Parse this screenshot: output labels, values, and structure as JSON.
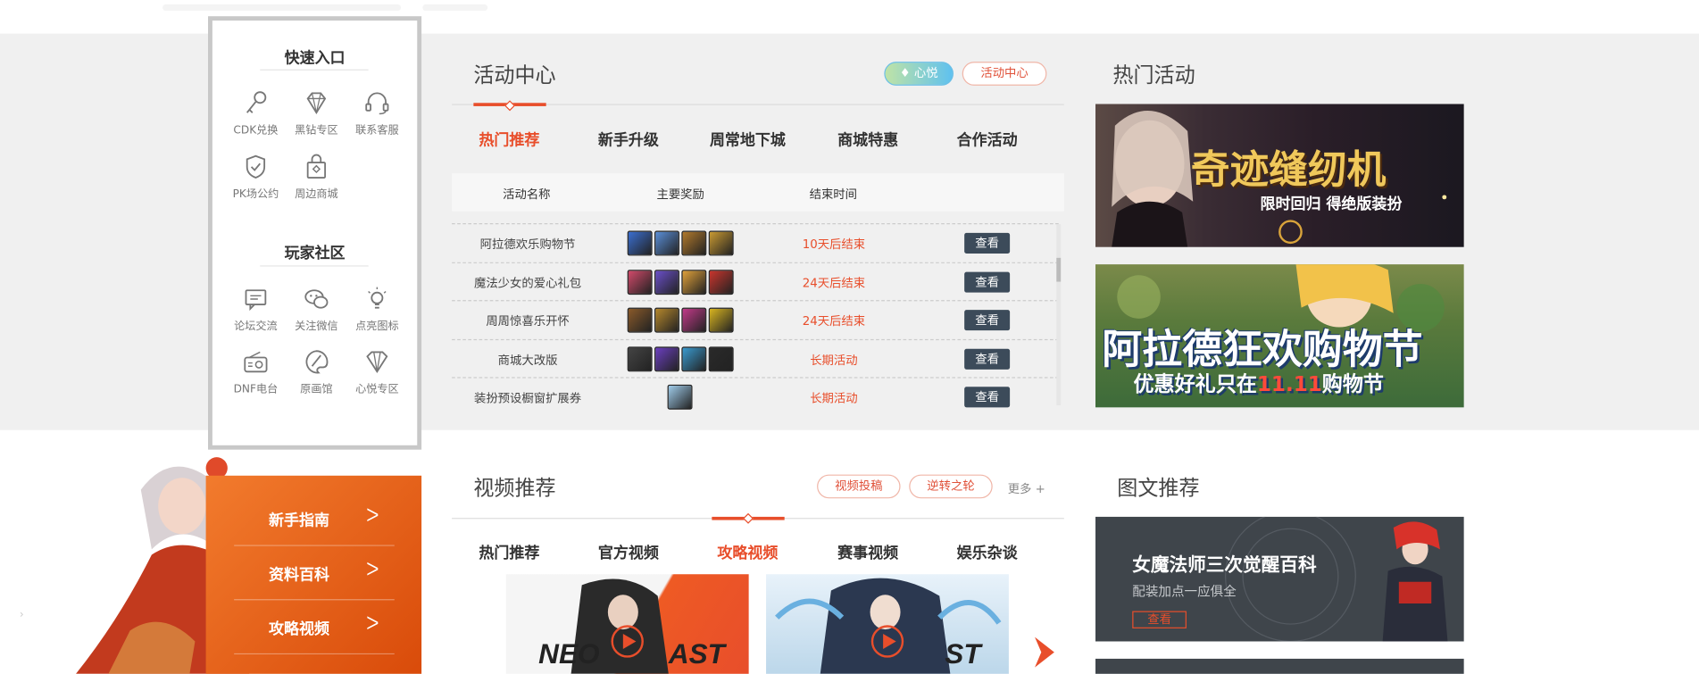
{
  "quick_entry": {
    "title": "快速入口",
    "items": [
      {
        "label": "CDK兑换",
        "icon": "key-icon"
      },
      {
        "label": "黑钻专区",
        "icon": "diamond-icon"
      },
      {
        "label": "联系客服",
        "icon": "headset-icon"
      },
      {
        "label": "PK场公约",
        "icon": "shield-icon"
      },
      {
        "label": "周边商城",
        "icon": "shopping-bag-icon"
      }
    ]
  },
  "community": {
    "title": "玩家社区",
    "items": [
      {
        "label": "论坛交流",
        "icon": "chat-icon"
      },
      {
        "label": "关注微信",
        "icon": "wechat-icon"
      },
      {
        "label": "点亮图标",
        "icon": "lightbulb-icon"
      },
      {
        "label": "DNF电台",
        "icon": "radio-icon"
      },
      {
        "label": "原画馆",
        "icon": "palette-icon"
      },
      {
        "label": "心悦专区",
        "icon": "gem-icon"
      }
    ]
  },
  "activity_center": {
    "title": "活动中心",
    "pill_xinyue": "心悦",
    "pill_center": "活动中心",
    "tabs": [
      "热门推荐",
      "新手升级",
      "周常地下城",
      "商城特惠",
      "合作活动"
    ],
    "active_tab": "热门推荐",
    "columns": [
      "活动名称",
      "主要奖励",
      "结束时间"
    ],
    "rows": [
      {
        "name": "阿拉德欢乐购物节",
        "end": "10天后结束",
        "button": "查看",
        "reward_count": 4
      },
      {
        "name": "魔法少女的爱心礼包",
        "end": "24天后结束",
        "button": "查看",
        "reward_count": 4
      },
      {
        "name": "周周惊喜乐开怀",
        "end": "24天后结束",
        "button": "查看",
        "reward_count": 4
      },
      {
        "name": "商城大改版",
        "end": "长期活动",
        "button": "查看",
        "reward_count": 4
      },
      {
        "name": "装扮预设橱窗扩展券",
        "end": "长期活动",
        "button": "查看",
        "reward_count": 1
      }
    ]
  },
  "hot_activities": {
    "title": "热门活动",
    "banners": [
      {
        "title": "奇迹缝纫机",
        "subtitle": "限时回归 得绝版装扮"
      },
      {
        "title": "阿拉德狂欢购物节",
        "subtitle_prefix": "优惠好礼只在",
        "subtitle_highlight": "11.11",
        "subtitle_suffix": "购物节"
      }
    ]
  },
  "video": {
    "title": "视频推荐",
    "pill_submit": "视频投稿",
    "pill_wheel": "逆转之轮",
    "more": "更多 +",
    "tabs": [
      "热门推荐",
      "官方视频",
      "攻略视频",
      "赛事视频",
      "娱乐杂谈"
    ],
    "active_tab": "攻略视频"
  },
  "guide_nav": {
    "items": [
      "新手指南",
      "资料百科",
      "攻略视频"
    ],
    "arrow": "ᐳ"
  },
  "article": {
    "title": "图文推荐",
    "card_title": "女魔法师三次觉醒百科",
    "card_sub": "配装加点一应俱全",
    "card_button": "查看"
  },
  "colors": {
    "accent": "#e84e2b",
    "button_dark": "#3c4b5a",
    "band_gray": "#f0f0f0"
  }
}
